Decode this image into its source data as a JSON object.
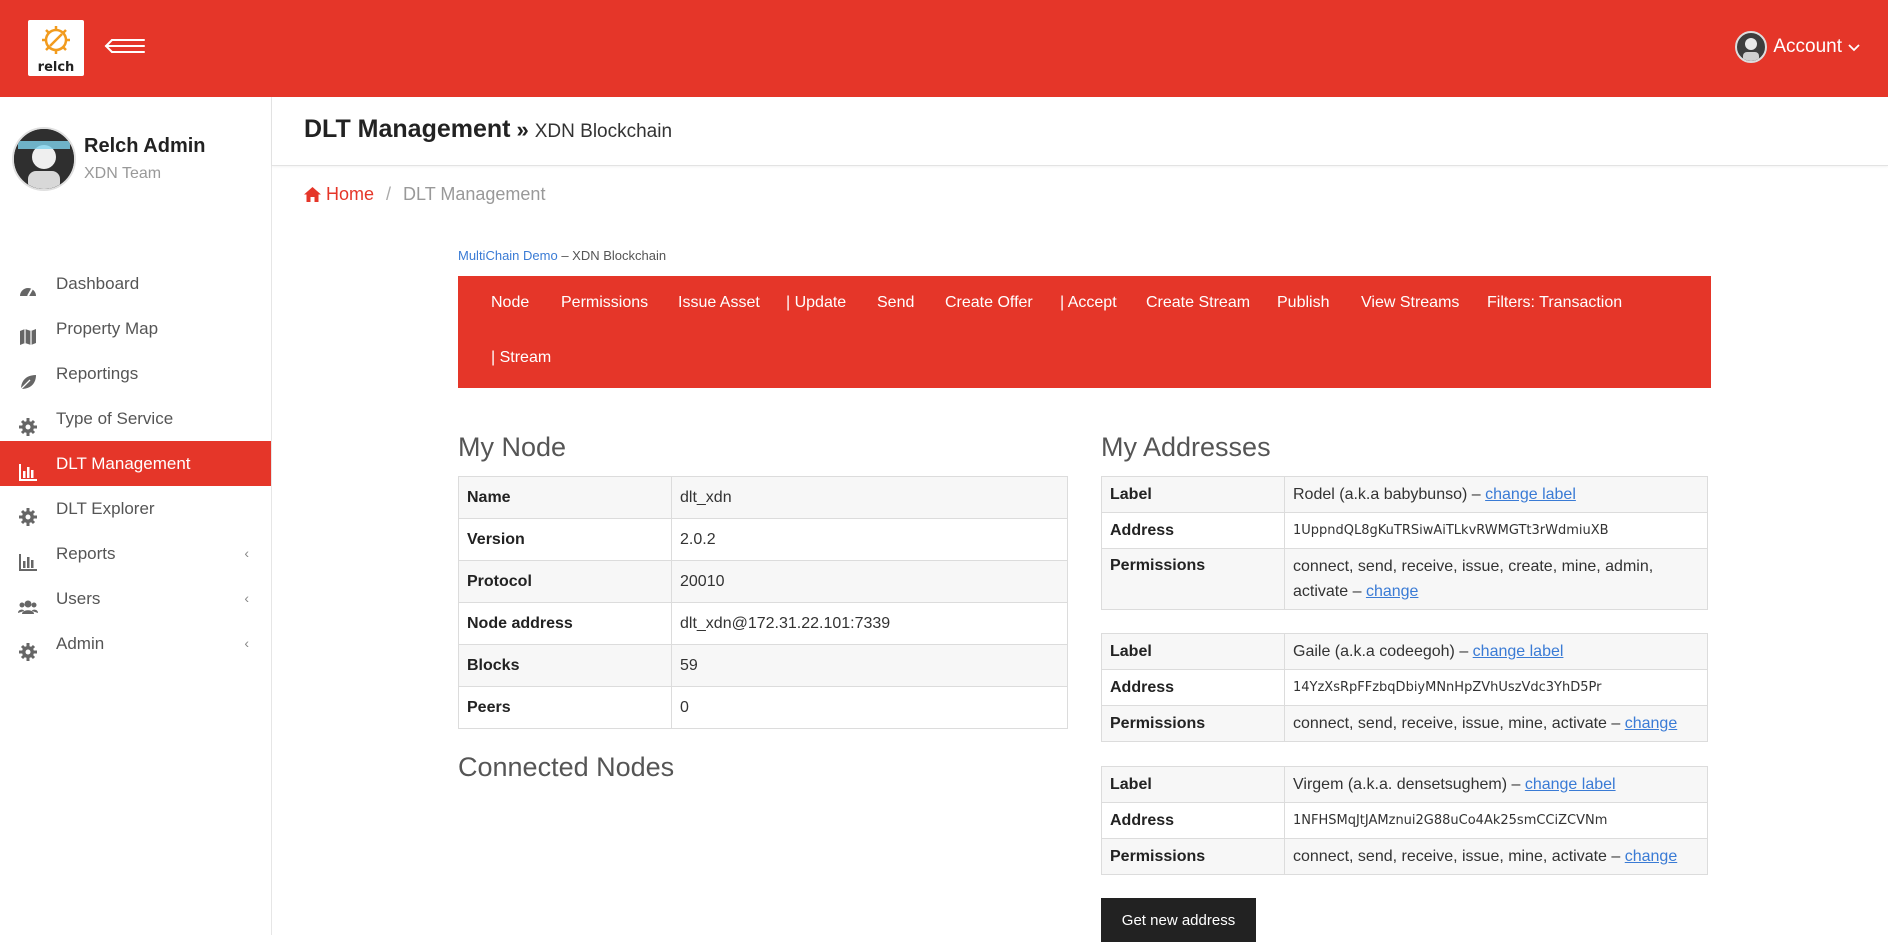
{
  "app": {
    "logo_text": "relch",
    "account_label": "Account"
  },
  "profile": {
    "name": "Relch Admin",
    "team": "XDN Team"
  },
  "sidebar": {
    "items": [
      {
        "label": "Dashboard",
        "icon": "dashboard-icon"
      },
      {
        "label": "Property Map",
        "icon": "map-icon"
      },
      {
        "label": "Reportings",
        "icon": "leaf-icon"
      },
      {
        "label": "Type of Service",
        "icon": "gear-icon"
      },
      {
        "label": "DLT Management",
        "icon": "bar-chart-icon",
        "active": true
      },
      {
        "label": "DLT Explorer",
        "icon": "gear-icon"
      },
      {
        "label": "Reports",
        "icon": "bar-chart-icon",
        "has_children": true
      },
      {
        "label": "Users",
        "icon": "users-icon",
        "has_children": true
      },
      {
        "label": "Admin",
        "icon": "gear-icon",
        "has_children": true
      }
    ],
    "caret": "‹"
  },
  "header": {
    "title": "DLT Management",
    "separator": "»",
    "subtitle": "XDN Blockchain"
  },
  "breadcrumb": {
    "home": "Home",
    "current": "DLT Management"
  },
  "demo": {
    "link": "MultiChain Demo",
    "suffix": " – XDN Blockchain"
  },
  "menu": {
    "items": [
      "Node",
      "Permissions",
      "Issue Asset",
      "| Update",
      "Send",
      "Create Offer",
      "| Accept",
      "Create Stream",
      "Publish",
      "View Streams",
      "Filters: Transaction",
      "| Stream"
    ]
  },
  "my_node": {
    "heading": "My Node",
    "rows": [
      {
        "key": "Name",
        "value": "dlt_xdn"
      },
      {
        "key": "Version",
        "value": "2.0.2"
      },
      {
        "key": "Protocol",
        "value": "20010"
      },
      {
        "key": "Node address",
        "value": "dlt_xdn@172.31.22.101:7339"
      },
      {
        "key": "Blocks",
        "value": "59"
      },
      {
        "key": "Peers",
        "value": "0"
      }
    ]
  },
  "connected_nodes": {
    "heading": "Connected Nodes"
  },
  "my_addresses": {
    "heading": "My Addresses",
    "keys": {
      "label": "Label",
      "address": "Address",
      "permissions": "Permissions"
    },
    "entries": [
      {
        "label": "Rodel (a.k.a babybunso) – ",
        "label_link": "change label",
        "address": "1UppndQL8gKuTRSiwAiTLkvRWMGTt3rWdmiuXB",
        "permissions": "connect, send, receive, issue, create, mine, admin, activate – ",
        "permissions_link": "change"
      },
      {
        "label": "Gaile (a.k.a codeegoh) – ",
        "label_link": "change label",
        "address": "14YzXsRpFFzbqDbiyMNnHpZVhUszVdc3YhD5Pr",
        "permissions": "connect, send, receive, issue, mine, activate – ",
        "permissions_link": "change"
      },
      {
        "label": "Virgem (a.k.a. densetsughem) – ",
        "label_link": "change label",
        "address": "1NFHSMqJtJAMznui2G88uCo4Ak25smCCiZCVNm",
        "permissions": "connect, send, receive, issue, mine, activate – ",
        "permissions_link": "change"
      }
    ],
    "new_address_button": "Get new address"
  },
  "colors": {
    "brand": "#e53629",
    "link": "#3a7bd5",
    "button_dark": "#222222"
  }
}
